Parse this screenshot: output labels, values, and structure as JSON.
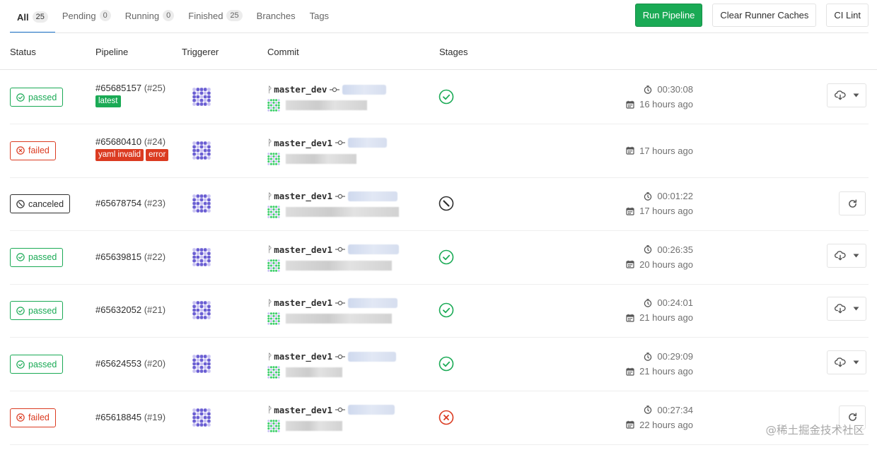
{
  "tabs": [
    {
      "label": "All",
      "count": "25"
    },
    {
      "label": "Pending",
      "count": "0"
    },
    {
      "label": "Running",
      "count": "0"
    },
    {
      "label": "Finished",
      "count": "25"
    },
    {
      "label": "Branches"
    },
    {
      "label": "Tags"
    }
  ],
  "actions": {
    "run_pipeline": "Run Pipeline",
    "clear_caches": "Clear Runner Caches",
    "ci_lint": "CI Lint"
  },
  "columns": {
    "status": "Status",
    "pipeline": "Pipeline",
    "triggerer": "Triggerer",
    "commit": "Commit",
    "stages": "Stages"
  },
  "rows": [
    {
      "status": "passed",
      "id": "#65685157",
      "iid": "(#25)",
      "labels": [
        "latest"
      ],
      "branch": "master_dev",
      "stage": "passed",
      "duration": "00:30:08",
      "finished": "16 hours ago",
      "action": "dropdown"
    },
    {
      "status": "failed",
      "id": "#65680410",
      "iid": "(#24)",
      "labels": [
        "yaml invalid",
        "error"
      ],
      "branch": "master_dev1",
      "stage": "",
      "duration": "",
      "finished": "17 hours ago",
      "action": ""
    },
    {
      "status": "canceled",
      "id": "#65678754",
      "iid": "(#23)",
      "labels": [],
      "branch": "master_dev1",
      "stage": "canceled",
      "duration": "00:01:22",
      "finished": "17 hours ago",
      "action": "retry"
    },
    {
      "status": "passed",
      "id": "#65639815",
      "iid": "(#22)",
      "labels": [],
      "branch": "master_dev1",
      "stage": "passed",
      "duration": "00:26:35",
      "finished": "20 hours ago",
      "action": "dropdown"
    },
    {
      "status": "passed",
      "id": "#65632052",
      "iid": "(#21)",
      "labels": [],
      "branch": "master_dev1",
      "stage": "passed",
      "duration": "00:24:01",
      "finished": "21 hours ago",
      "action": "dropdown"
    },
    {
      "status": "passed",
      "id": "#65624553",
      "iid": "(#20)",
      "labels": [],
      "branch": "master_dev1",
      "stage": "passed",
      "duration": "00:29:09",
      "finished": "21 hours ago",
      "action": "dropdown"
    },
    {
      "status": "failed",
      "id": "#65618845",
      "iid": "(#19)",
      "labels": [],
      "branch": "master_dev1",
      "stage": "failed",
      "duration": "00:27:34",
      "finished": "22 hours ago",
      "action": "retry"
    }
  ],
  "watermark": "@稀土掘金技术社区",
  "colors": {
    "success": "#1aaa55",
    "danger": "#db3b21",
    "primary": "#1f78d1",
    "avatar": "#6b5fd3"
  }
}
